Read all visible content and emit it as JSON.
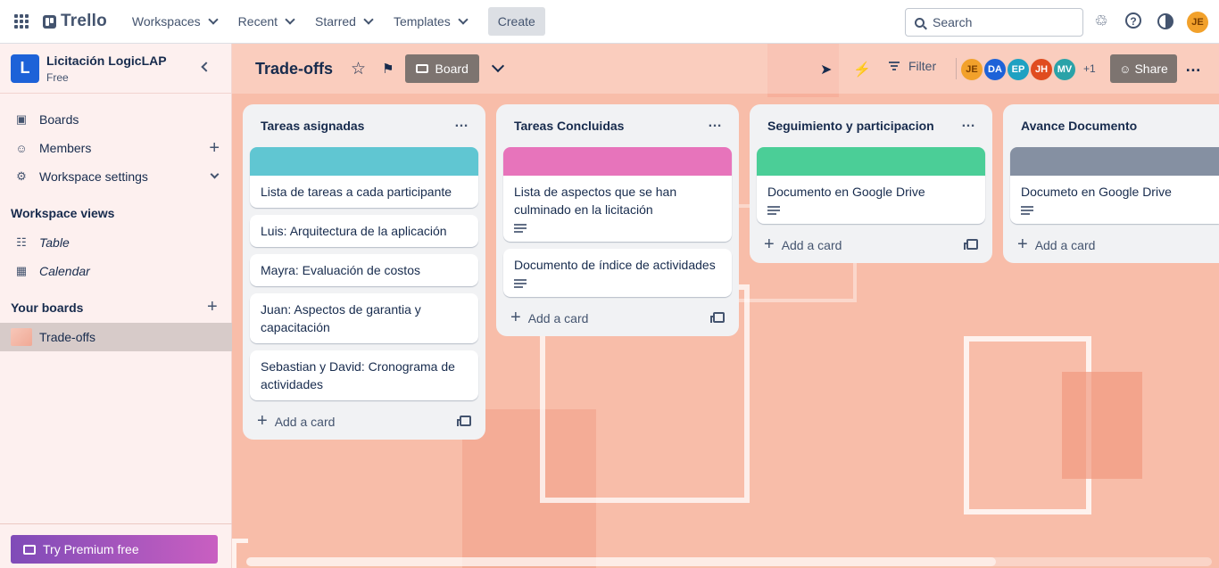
{
  "topbar": {
    "brand": "Trello",
    "nav": [
      "Workspaces",
      "Recent",
      "Starred",
      "Templates"
    ],
    "create_label": "Create",
    "search_placeholder": "Search",
    "user_initials": "JE"
  },
  "sidebar": {
    "workspace_initial": "L",
    "workspace_name": "Licitación LogicLAP",
    "workspace_plan": "Free",
    "items": [
      {
        "label": "Boards",
        "icon": "trello-icon"
      },
      {
        "label": "Members",
        "icon": "person-icon"
      },
      {
        "label": "Workspace settings",
        "icon": "gear-icon"
      }
    ],
    "views_heading": "Workspace views",
    "views": [
      {
        "label": "Table",
        "icon": "table-icon"
      },
      {
        "label": "Calendar",
        "icon": "calendar-icon"
      }
    ],
    "boards_heading": "Your boards",
    "boards": [
      {
        "label": "Trade-offs"
      }
    ],
    "premium_label": "Try Premium free"
  },
  "board": {
    "title": "Trade-offs",
    "view_label": "Board",
    "filter_label": "Filter",
    "members": [
      {
        "initials": "JE",
        "color": "#f2a12b"
      },
      {
        "initials": "DA",
        "color": "#1d62d8"
      },
      {
        "initials": "EP",
        "color": "#1fa1c2"
      },
      {
        "initials": "JH",
        "color": "#e04c1f"
      },
      {
        "initials": "MV",
        "color": "#2aa2a8"
      }
    ],
    "extra_members": "+1",
    "share_label": "Share"
  },
  "lists": [
    {
      "title": "Tareas asignadas",
      "cover_color": "#60c6d2",
      "cards": [
        {
          "text": "Lista de tareas a cada participante",
          "has_desc": false
        },
        {
          "text": "Luis: Arquitectura de la aplicación",
          "has_desc": false
        },
        {
          "text": "Mayra: Evaluación de costos",
          "has_desc": false
        },
        {
          "text": "Juan: Aspectos de garantia y capacitación",
          "has_desc": false
        },
        {
          "text": "Sebastian y David: Cronograma de actividades",
          "has_desc": false
        }
      ],
      "add_label": "Add a card"
    },
    {
      "title": "Tareas Concluidas",
      "cover_color": "#e774bb",
      "cards": [
        {
          "text": "Lista de aspectos que se han culminado en la licitación",
          "has_desc": true
        },
        {
          "text": "Documento de índice de actividades",
          "has_desc": true
        }
      ],
      "add_label": "Add a card"
    },
    {
      "title": "Seguimiento y participacion",
      "cover_color": "#4bce97",
      "cards": [
        {
          "text": "Documento en Google Drive",
          "has_desc": true
        }
      ],
      "add_label": "Add a card"
    },
    {
      "title": "Avance Documento",
      "cover_color": "#8590a2",
      "cards": [
        {
          "text": "Documeto en Google Drive",
          "has_desc": true
        }
      ],
      "add_label": "Add a card"
    }
  ]
}
